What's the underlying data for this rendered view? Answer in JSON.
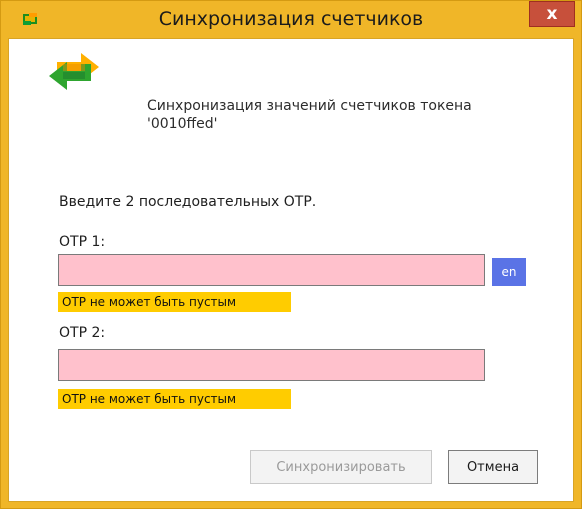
{
  "window": {
    "title": "Синхронизация счетчиков",
    "close_label": "x",
    "accent_color": "#f0b628",
    "close_color": "#c7503b"
  },
  "header": {
    "icon": "sync-arrows-icon",
    "text": "Синхронизация значений счетчиков токена\n'0010ffed'"
  },
  "form": {
    "instruction": "Введите 2 последовательных ОТР.",
    "otp1": {
      "label": "ОТР 1:",
      "value": "",
      "error": "ОТР не может быть пустым",
      "input_bg": "#ffc1cc"
    },
    "otp2": {
      "label": "ОТР 2:",
      "value": "",
      "error": "ОТР не может быть пустым",
      "input_bg": "#ffc1cc"
    },
    "language_badge": "en",
    "language_badge_color": "#5a73e6",
    "error_color": "#ffcc00"
  },
  "buttons": {
    "sync": "Синхронизировать",
    "cancel": "Отмена"
  }
}
